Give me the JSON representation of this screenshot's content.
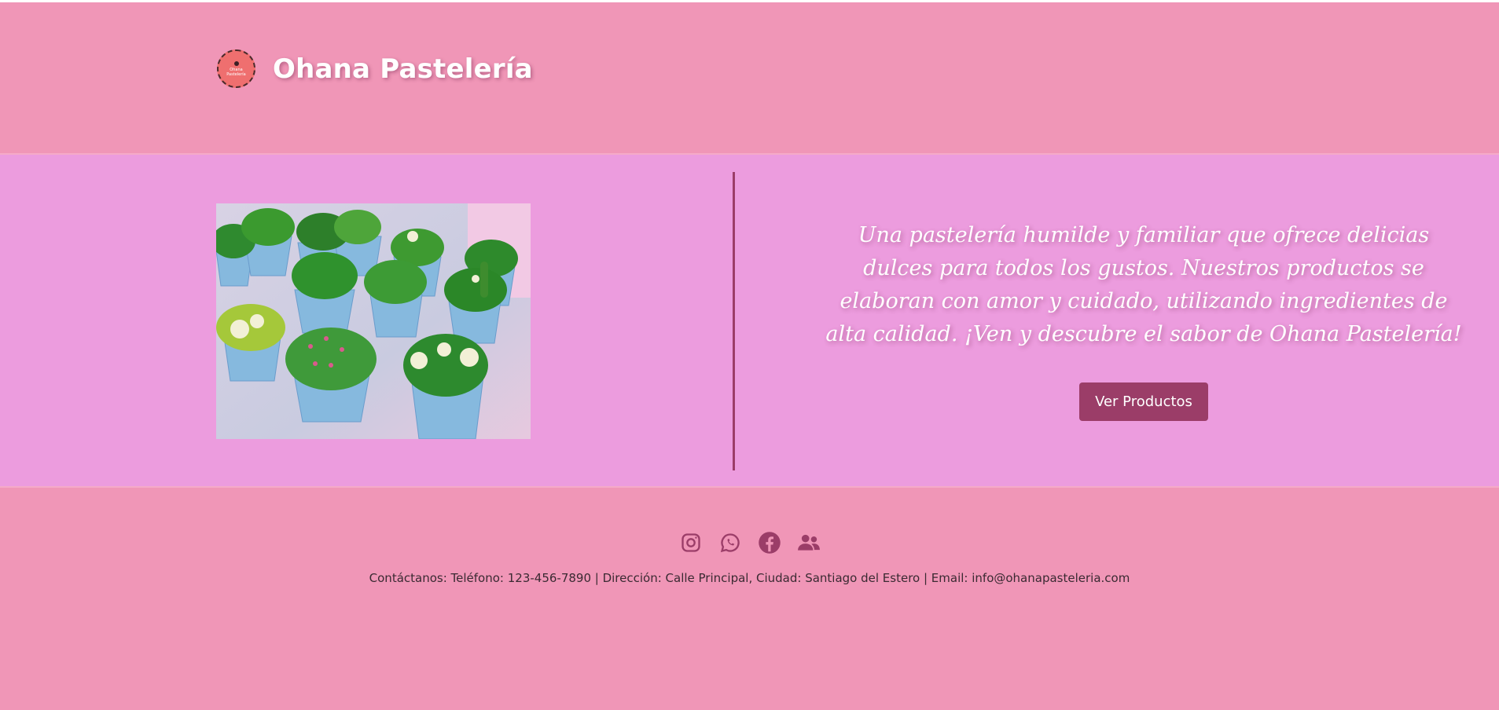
{
  "brand": {
    "title": "Ohana Pastelería",
    "logo_text_line1": "Ohana",
    "logo_text_line2": "Pastelería"
  },
  "hero": {
    "image_alt": "Cupcakes decorados como suculentas y cactus",
    "tagline": "Una pastelería humilde y familiar que ofrece delicias dulces para todos los gustos. Nuestros productos se elaboran con amor y cuidado, utilizando ingredientes de alta calidad. ¡Ven y descubre el sabor de Ohana Pastelería!",
    "cta_label": "Ver Productos"
  },
  "footer": {
    "socials": [
      {
        "icon": "instagram-icon"
      },
      {
        "icon": "whatsapp-icon"
      },
      {
        "icon": "facebook-icon"
      },
      {
        "icon": "users-icon"
      }
    ],
    "contact": "Contáctanos: Teléfono: 123-456-7890 | Dirección: Calle Principal, Ciudad: Santiago del Estero | Email: info@ohanapasteleria.com"
  },
  "colors": {
    "header_bg": "#f096b7",
    "hero_bg": "#ec9cde",
    "accent": "#9b3d68",
    "text_light": "#ffffff"
  }
}
